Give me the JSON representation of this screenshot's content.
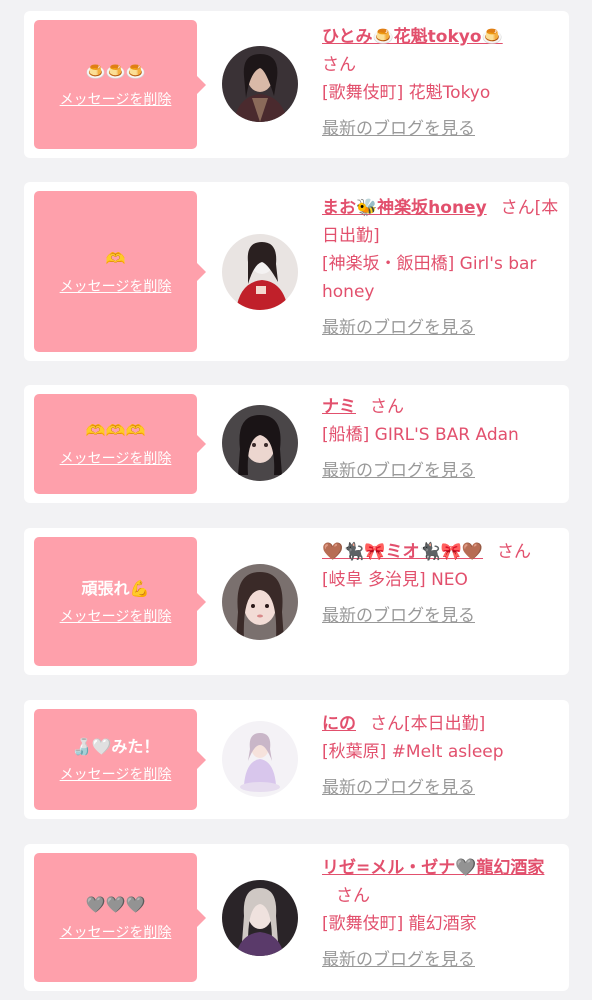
{
  "colors": {
    "accent": "#e2506d",
    "bubble": "#fea0ab",
    "link_gray": "#999999",
    "background": "#f2f2f4"
  },
  "delete_label": "メッセージを削除",
  "blog_label": "最新のブログを見る",
  "honorific": "さん",
  "cards": [
    {
      "message": "🍮🍮🍮",
      "name": "ひとみ🍮花魁tokyo🍮",
      "status": "",
      "shop": "[歌舞伎町] 花魁Tokyo",
      "avatar": "woman-dark-hair-kimono"
    },
    {
      "message": "🫶",
      "name": "まお🐝神楽坂honey",
      "status": "[本日出勤]",
      "shop": "[神楽坂・飯田橋] Girl's bar honey",
      "avatar": "woman-red-dress"
    },
    {
      "message": "🫶🫶🫶",
      "name": "ナミ",
      "status": "",
      "shop": "[船橋] GIRL'S BAR Adan",
      "avatar": "woman-dark-hair-closeup"
    },
    {
      "message": "頑張れ💪",
      "name": "🤎🐈‍⬛🎀ミオ🐈‍⬛🎀🤎",
      "status": "",
      "shop": "[岐阜 多治見] NEO",
      "avatar": "woman-bangs-closeup"
    },
    {
      "message": "🍶🤍みた！",
      "name": "にの",
      "status": "[本日出勤]",
      "shop": "[秋葉原] #Melt asleep",
      "avatar": "woman-pastel-outfit"
    },
    {
      "message": "🩶🩶🩶",
      "name": "リゼ=メル・ゼナ🩶龍幻酒家",
      "status": "",
      "shop": "[歌舞伎町] 龍幻酒家",
      "avatar": "woman-silver-hair"
    }
  ]
}
